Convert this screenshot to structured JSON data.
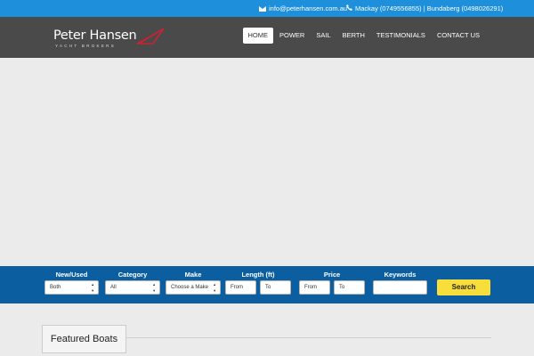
{
  "topbar": {
    "email": "info@peterhansen.com.au",
    "phones": "Mackay (0749556855) | Bundaberg (0498026291)"
  },
  "logo": {
    "name": "Peter Hansen",
    "tagline": "YACHT BROKERS"
  },
  "nav": {
    "items": [
      "HOME",
      "POWER",
      "SAIL",
      "BERTH",
      "TESTIMONIALS",
      "CONTACT US"
    ],
    "active": "HOME"
  },
  "search": {
    "labels": {
      "new_used": "New/Used",
      "category": "Category",
      "make": "Make",
      "length": "Length (ft)",
      "price": "Price",
      "keywords": "Keywords"
    },
    "fields": {
      "new_used": "Both",
      "category": "All",
      "make": "Choose a Make",
      "length_from": "From",
      "length_to": "To",
      "price_from": "From",
      "price_to": "To",
      "keywords": ""
    },
    "button": "Search"
  },
  "featured": {
    "title": "Featured Boats"
  },
  "colors": {
    "topbar": "#1d8fdb",
    "header": "#4a4a4a",
    "search_bar": "#0b5fa0",
    "search_button": "#f7de3a",
    "logo_accent": "#e31b2f"
  }
}
